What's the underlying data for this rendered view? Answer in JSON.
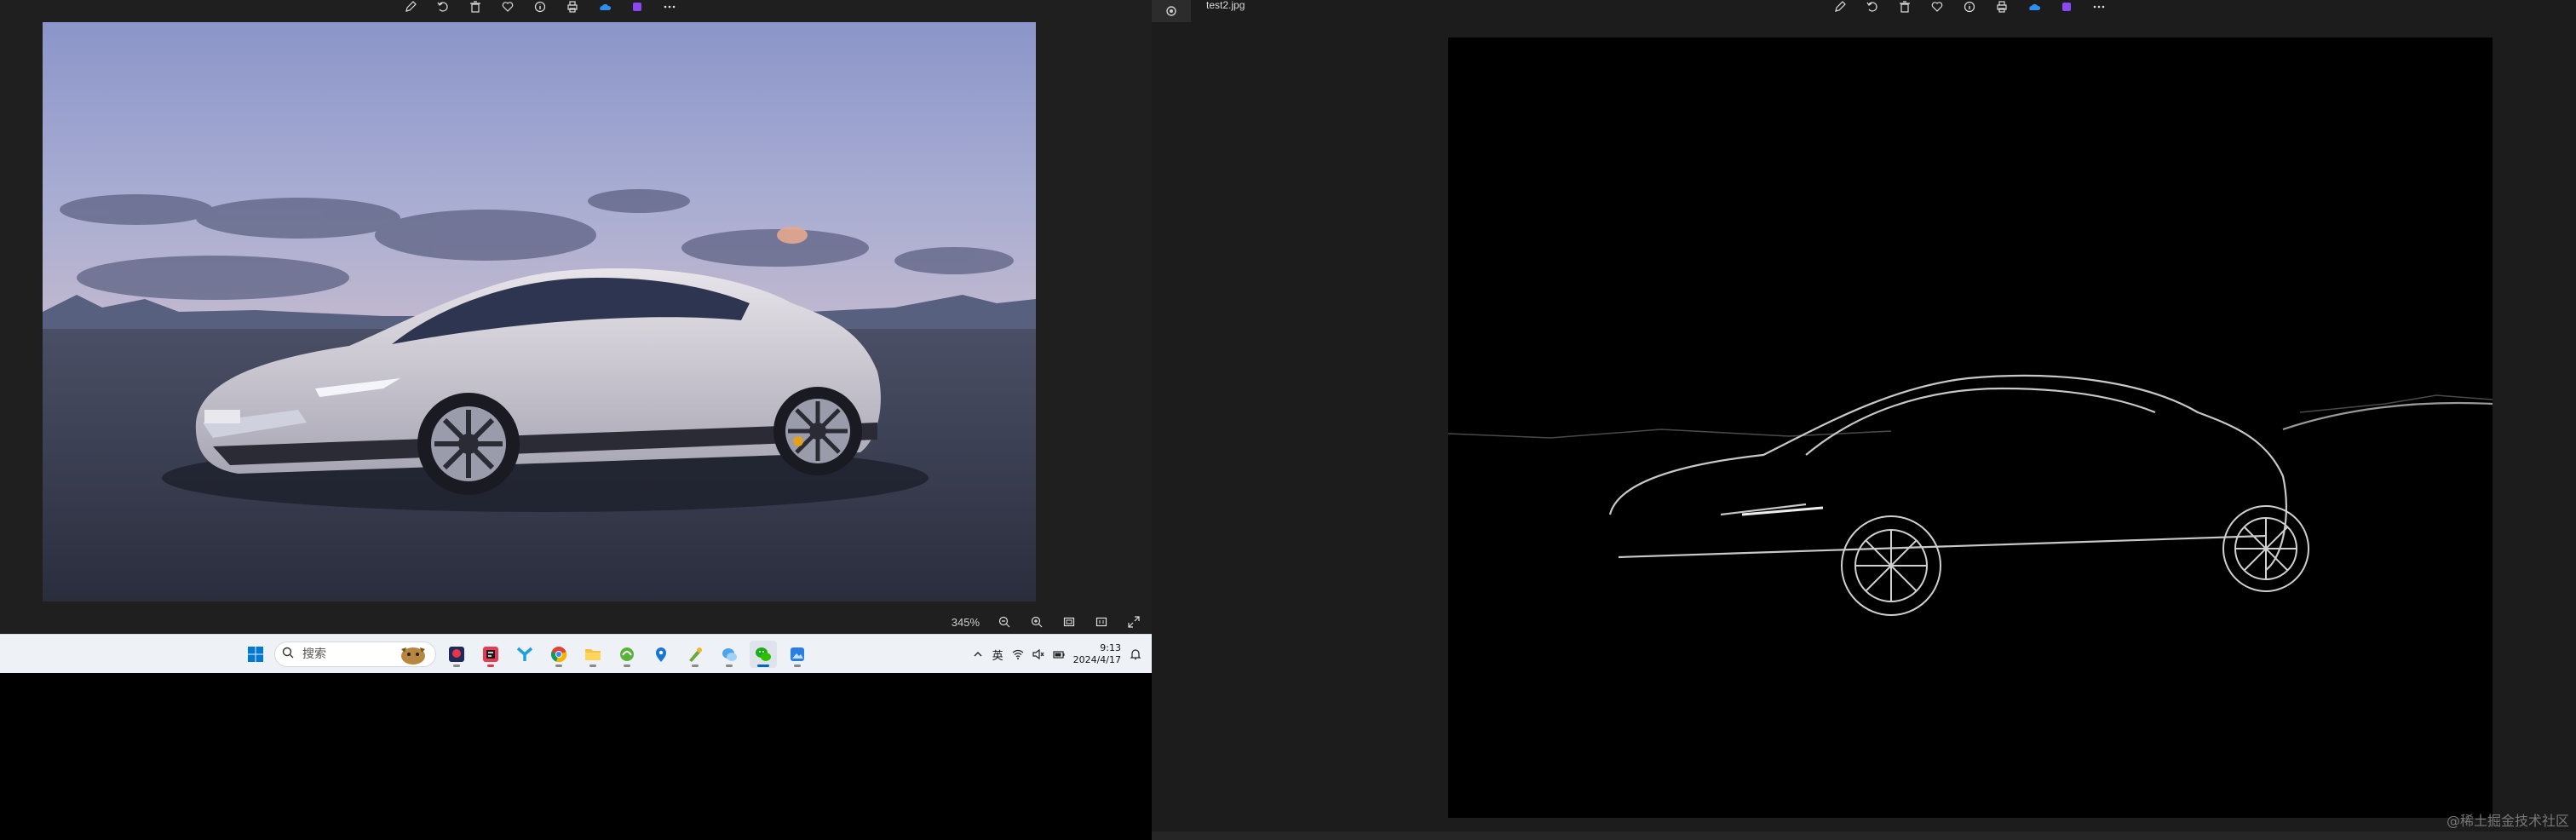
{
  "left_window": {
    "toolbar_icons": [
      "edit-icon",
      "rotate-icon",
      "delete-icon",
      "heart-icon",
      "info-icon",
      "print-icon",
      "onedrive-icon",
      "clipchamp-icon",
      "more-icon"
    ],
    "photo_name": "car-photo",
    "status": {
      "zoom_level": "345%"
    }
  },
  "taskbar": {
    "search_placeholder": "搜索",
    "apps": [
      "windows-start-icon",
      "app-icon-1",
      "app-icon-2",
      "app-icon-3",
      "chrome-icon",
      "file-explorer-icon",
      "app-icon-4",
      "maps-icon",
      "app-icon-5",
      "app-icon-6",
      "wechat-icon",
      "photos-icon"
    ],
    "tray": {
      "ime_label": "英",
      "time": "9:13",
      "date": "2024/4/17"
    }
  },
  "right_window": {
    "filename": "test2.jpg",
    "toolbar_icons": [
      "edit-icon",
      "rotate-icon",
      "delete-icon",
      "heart-icon",
      "info-icon",
      "print-icon",
      "onedrive-icon",
      "clipchamp-icon",
      "more-icon"
    ],
    "image_name": "edge-detection-result"
  },
  "watermark": "@稀土掘金技术社区",
  "colors": {
    "accent": "#0067c0",
    "viewer_bg": "#1f1f1f",
    "taskbar_bg": "#eef1f6"
  }
}
